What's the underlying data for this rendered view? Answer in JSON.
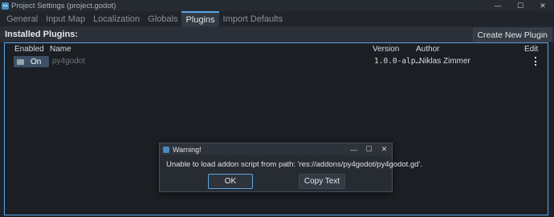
{
  "window": {
    "title": "Project Settings (project.godot)",
    "controls": {
      "minimize": "—",
      "maximize": "☐",
      "close": "✕"
    }
  },
  "tabs": [
    {
      "label": "General"
    },
    {
      "label": "Input Map"
    },
    {
      "label": "Localization"
    },
    {
      "label": "Globals"
    },
    {
      "label": "Plugins"
    },
    {
      "label": "Import Defaults"
    }
  ],
  "plugins_header": {
    "title": "Installed Plugins:",
    "create_button": "Create New Plugin"
  },
  "table": {
    "columns": {
      "enabled": "Enabled",
      "name": "Name",
      "version": "Version",
      "author": "Author",
      "edit": "Edit"
    },
    "rows": [
      {
        "enabled": "On",
        "name": "py4godot",
        "version": "1.0.0-alp…",
        "author": "Niklas Zimmer",
        "edit_icon": "edit-icon"
      }
    ]
  },
  "dialog": {
    "title": "Warning!",
    "controls": {
      "minimize": "—",
      "maximize": "☐",
      "close": "✕"
    },
    "message": "Unable to load addon script from path: 'res://addons/py4godot/py4godot.gd'.",
    "ok_label": "OK",
    "copy_label": "Copy Text"
  },
  "colors": {
    "accent": "#5aa5e6",
    "background": "#1f2329",
    "godot_blue": "#478cbf"
  }
}
